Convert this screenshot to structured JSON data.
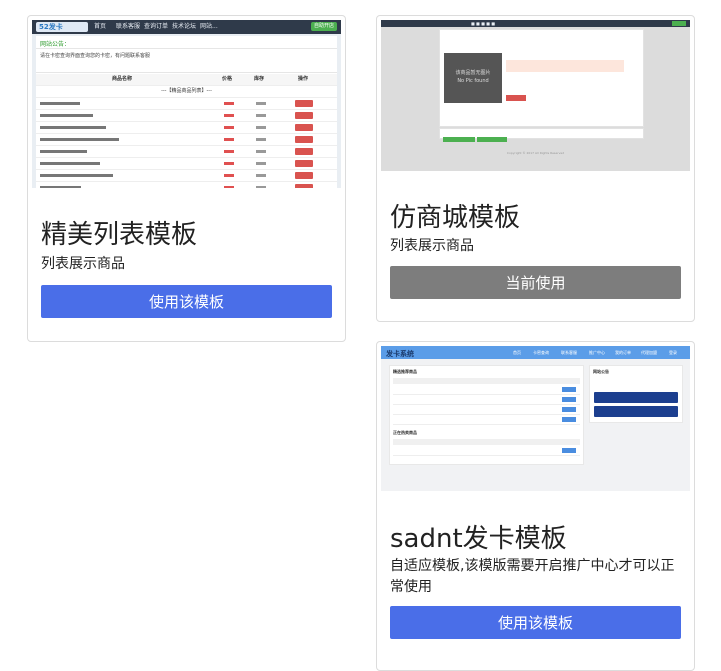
{
  "templates": [
    {
      "title": "精美列表模板",
      "description": "列表展示商品",
      "button_label": "使用该模板",
      "button_state": "available",
      "thumbnail": {
        "logo_text": "52发卡",
        "nav_items": [
          "首页",
          "联系客服",
          "查询订单",
          "技术论坛",
          "网站..."
        ],
        "nav_button": "自助开店",
        "notice_title": "网站公告：",
        "notice_text": "请在卡密查询界面查询您的卡密，有问题联系客服",
        "category_title": "---【精品商品列表】---",
        "table_headers": [
          "商品名称",
          "价格",
          "库存",
          "操作"
        ]
      }
    },
    {
      "title": "仿商城模板",
      "description": "列表展示商品",
      "button_label": "当前使用",
      "button_state": "current",
      "thumbnail": {
        "no_image_text": "该商品暂无图片",
        "no_image_text_en": "No Pic found",
        "footer_text": "Copyright © 2017 All Rights Reserved"
      }
    },
    {
      "title": "sadnt发卡模板",
      "description": "自适应模板,该模版需要开启推广中心才可以正常使用",
      "button_label": "使用该模板",
      "button_state": "available",
      "thumbnail": {
        "logo_text": "发卡系统",
        "nav_items": [
          "首页",
          "卡密查询",
          "联系客服",
          "推广中心",
          "我的订单",
          "代理加盟",
          "登录"
        ],
        "section_one": "精选推荐商品",
        "section_two": "正在热卖商品",
        "side_title": "网站公告"
      }
    }
  ],
  "colors": {
    "primary_button": "#4a6ee8",
    "current_button": "#7d7d7d",
    "card_border": "#dcdcdc"
  }
}
